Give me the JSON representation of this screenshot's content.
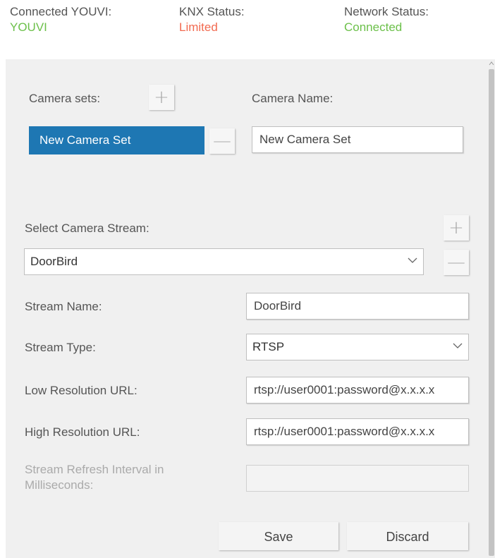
{
  "status": [
    {
      "label": "Connected YOUVI:",
      "value": "YOUVI",
      "color": "#6cc04a"
    },
    {
      "label": "KNX Status:",
      "value": "Limited",
      "color": "#f26a50"
    },
    {
      "label": "Network Status:",
      "value": "Connected",
      "color": "#6cc04a"
    }
  ],
  "camera_sets": {
    "label": "Camera sets:",
    "items": [
      "New Camera Set"
    ],
    "add_symbol": "+",
    "remove_symbol": "—"
  },
  "camera_name": {
    "label": "Camera Name:",
    "value": "New Camera Set"
  },
  "stream_select": {
    "label": "Select Camera Stream:",
    "selected": "DoorBird",
    "add_symbol": "+",
    "remove_symbol": "—"
  },
  "stream_name": {
    "label": "Stream Name:",
    "value": "DoorBird"
  },
  "stream_type": {
    "label": "Stream Type:",
    "selected": "RTSP"
  },
  "low_res_url": {
    "label": "Low Resolution URL:",
    "value": "rtsp://user0001:password@x.x.x.x"
  },
  "high_res_url": {
    "label": "High Resolution URL:",
    "value": "rtsp://user0001:password@x.x.x.x"
  },
  "refresh_interval": {
    "label_line1": "Stream Refresh Interval in",
    "label_line2": "Milliseconds:",
    "value": ""
  },
  "actions": {
    "save": "Save",
    "discard": "Discard"
  },
  "icons": {
    "chevron": "chevron-down-icon",
    "scroll_up": "scroll-up-arrow-icon"
  }
}
